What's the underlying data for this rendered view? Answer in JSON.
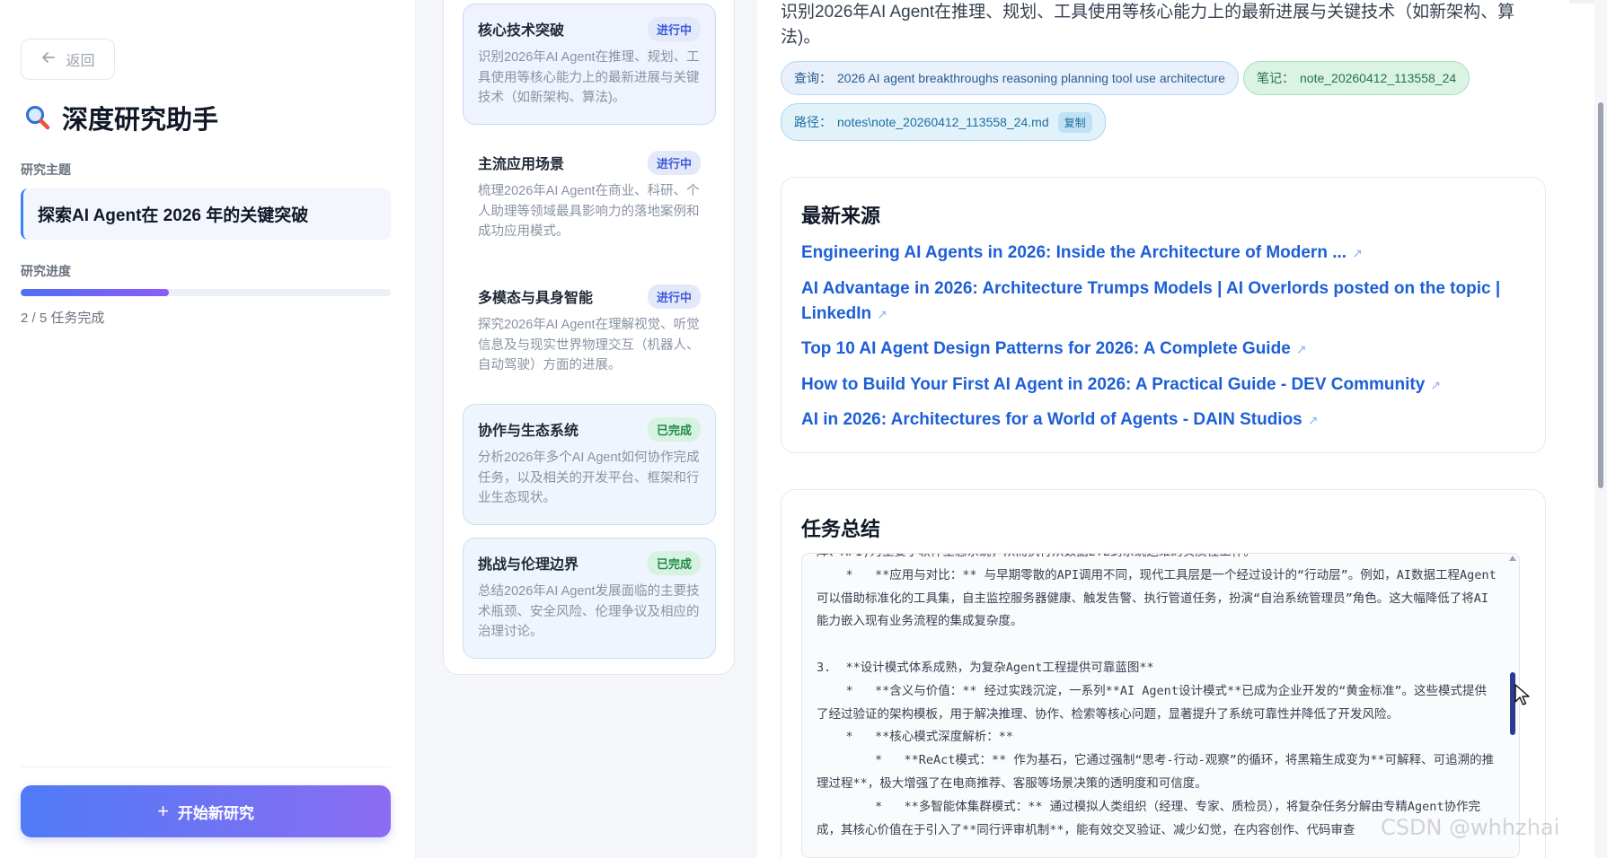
{
  "sidebar": {
    "back_label": "返回",
    "app_title": "深度研究助手",
    "topic_label": "研究主题",
    "topic_value": "探索AI Agent在 2026 年的关键突破",
    "progress_label": "研究进度",
    "progress_fraction": 0.4,
    "progress_text": "2 / 5 任务完成",
    "new_research_label": "开始新研究"
  },
  "tasks": [
    {
      "title": "核心技术突破",
      "status": "进行中",
      "state": "running",
      "style": "active",
      "desc": "识别2026年AI Agent在推理、规划、工具使用等核心能力上的最新进展与关键技术（如新架构、算法)。"
    },
    {
      "title": "主流应用场景",
      "status": "进行中",
      "state": "running",
      "style": "plain",
      "desc": "梳理2026年AI Agent在商业、科研、个人助理等领域最具影响力的落地案例和成功应用模式。"
    },
    {
      "title": "多模态与具身智能",
      "status": "进行中",
      "state": "running",
      "style": "plain",
      "desc": "探究2026年AI Agent在理解视觉、听觉信息及与现实世界物理交互（机器人、自动驾驶）方面的进展。"
    },
    {
      "title": "协作与生态系统",
      "status": "已完成",
      "state": "done",
      "style": "done",
      "desc": "分析2026年多个AI Agent如何协作完成任务，以及相关的开发平台、框架和行业生态现状。"
    },
    {
      "title": "挑战与伦理边界",
      "status": "已完成",
      "state": "done",
      "style": "done",
      "desc": "总结2026年AI Agent发展面临的主要技术瓶颈、安全风险、伦理争议及相应的治理讨论。"
    }
  ],
  "main": {
    "intro": "识别2026年AI Agent在推理、规划、工具使用等核心能力上的最新进展与关键技术（如新架构、算法)。",
    "query_label": "查询：",
    "query_value": "2026 AI agent breakthroughs reasoning planning tool use architecture",
    "note_label": "笔记：",
    "note_value": "note_20260412_113558_24",
    "path_label": "路径：",
    "path_value": "notes\\note_20260412_113558_24.md",
    "copy_label": "复制",
    "sources_title": "最新来源",
    "sources": [
      "Engineering AI Agents in 2026: Inside the Architecture of Modern ...",
      "AI Advantage in 2026: Architecture Trumps Models | AI Overlords posted on the topic | LinkedIn",
      "Top 10 AI Agent Design Patterns for 2026: A Complete Guide",
      "How to Build Your First AI Agent in 2026: A Practical Guide - DEV Community",
      "AI in 2026: Architectures for a World of Agents - DAIN Studios"
    ],
    "summary_title": "任务总结",
    "summary_text": "库、API)为主要了软件生态系统，从而执行从数据ETL到系统运维的实质性工作。\n    *   **应用与对比：** 与早期零散的API调用不同，现代工具层是一个经过设计的“行动层”。例如，AI数据工程Agent可以借助标准化的工具集，自主监控服务器健康、触发告警、执行管道任务，扮演“自治系统管理员”角色。这大幅降低了将AI能力嵌入现有业务流程的集成复杂度。\n\n3.  **设计模式体系成熟，为复杂Agent工程提供可靠蓝图**\n    *   **含义与价值：** 经过实践沉淀，一系列**AI Agent设计模式**已成为企业开发的“黄金标准”。这些模式提供了经过验证的架构模板，用于解决推理、协作、检索等核心问题，显著提升了系统可靠性并降低了开发风险。\n    *   **核心模式深度解析：**\n        *   **ReAct模式：** 作为基石，它通过强制“思考-行动-观察”的循环，将黑箱生成变为**可解释、可追溯的推理过程**，极大增强了在电商推荐、客服等场景决策的透明度和可信度。\n        *   **多智能体集群模式：** 通过模拟人类组织（经理、专家、质检员），将复杂任务分解由专精Agent协作完成，其核心价值在于引入了**同行评审机制**，能有效交叉验证、减少幻觉，在内容创作、代码审查"
  },
  "watermark": "CSDN @whhzhai"
}
